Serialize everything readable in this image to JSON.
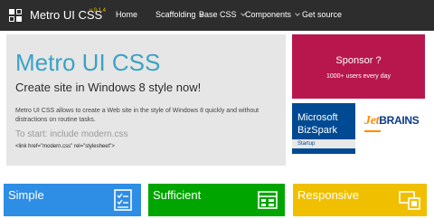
{
  "navbar": {
    "brand": "Metro UI CSS",
    "version": "v 0.1.4",
    "items": [
      {
        "label": "Home",
        "has_dropdown": false
      },
      {
        "label": "Scaffolding",
        "has_dropdown": true
      },
      {
        "label": "Base CSS",
        "has_dropdown": true
      },
      {
        "label": "Components",
        "has_dropdown": true
      },
      {
        "label": "Get source",
        "has_dropdown": false
      }
    ]
  },
  "hero": {
    "title": "Metro UI CSS",
    "subtitle": "Create site in Windows 8 style now!",
    "description": "Metro UI CSS allows to create a Web site in the style of Windows 8 quickly and without distractions on routine tasks.",
    "start_text": "To start: include modern.css",
    "code": "<link href=\"modern.css\" rel=\"stylesheet\">"
  },
  "sponsor": {
    "title": "Sponsor ?",
    "subtitle": "1000+ users every day",
    "color": "#b8174e"
  },
  "sponsors": {
    "bizspark": {
      "line1": "Microsoft",
      "line2": "BizSpark",
      "line3": "Startup"
    },
    "jetbrains": {
      "jet": "Jet",
      "brains": "BRAINS"
    }
  },
  "tiles": [
    {
      "label": "Simple",
      "icon": "checklist-icon",
      "color": "#2e8de5"
    },
    {
      "label": "Sufficient",
      "icon": "grid-layout-icon",
      "color": "#00a500"
    },
    {
      "label": "Responsive",
      "icon": "responsive-devices-icon",
      "color": "#f0c000"
    }
  ]
}
